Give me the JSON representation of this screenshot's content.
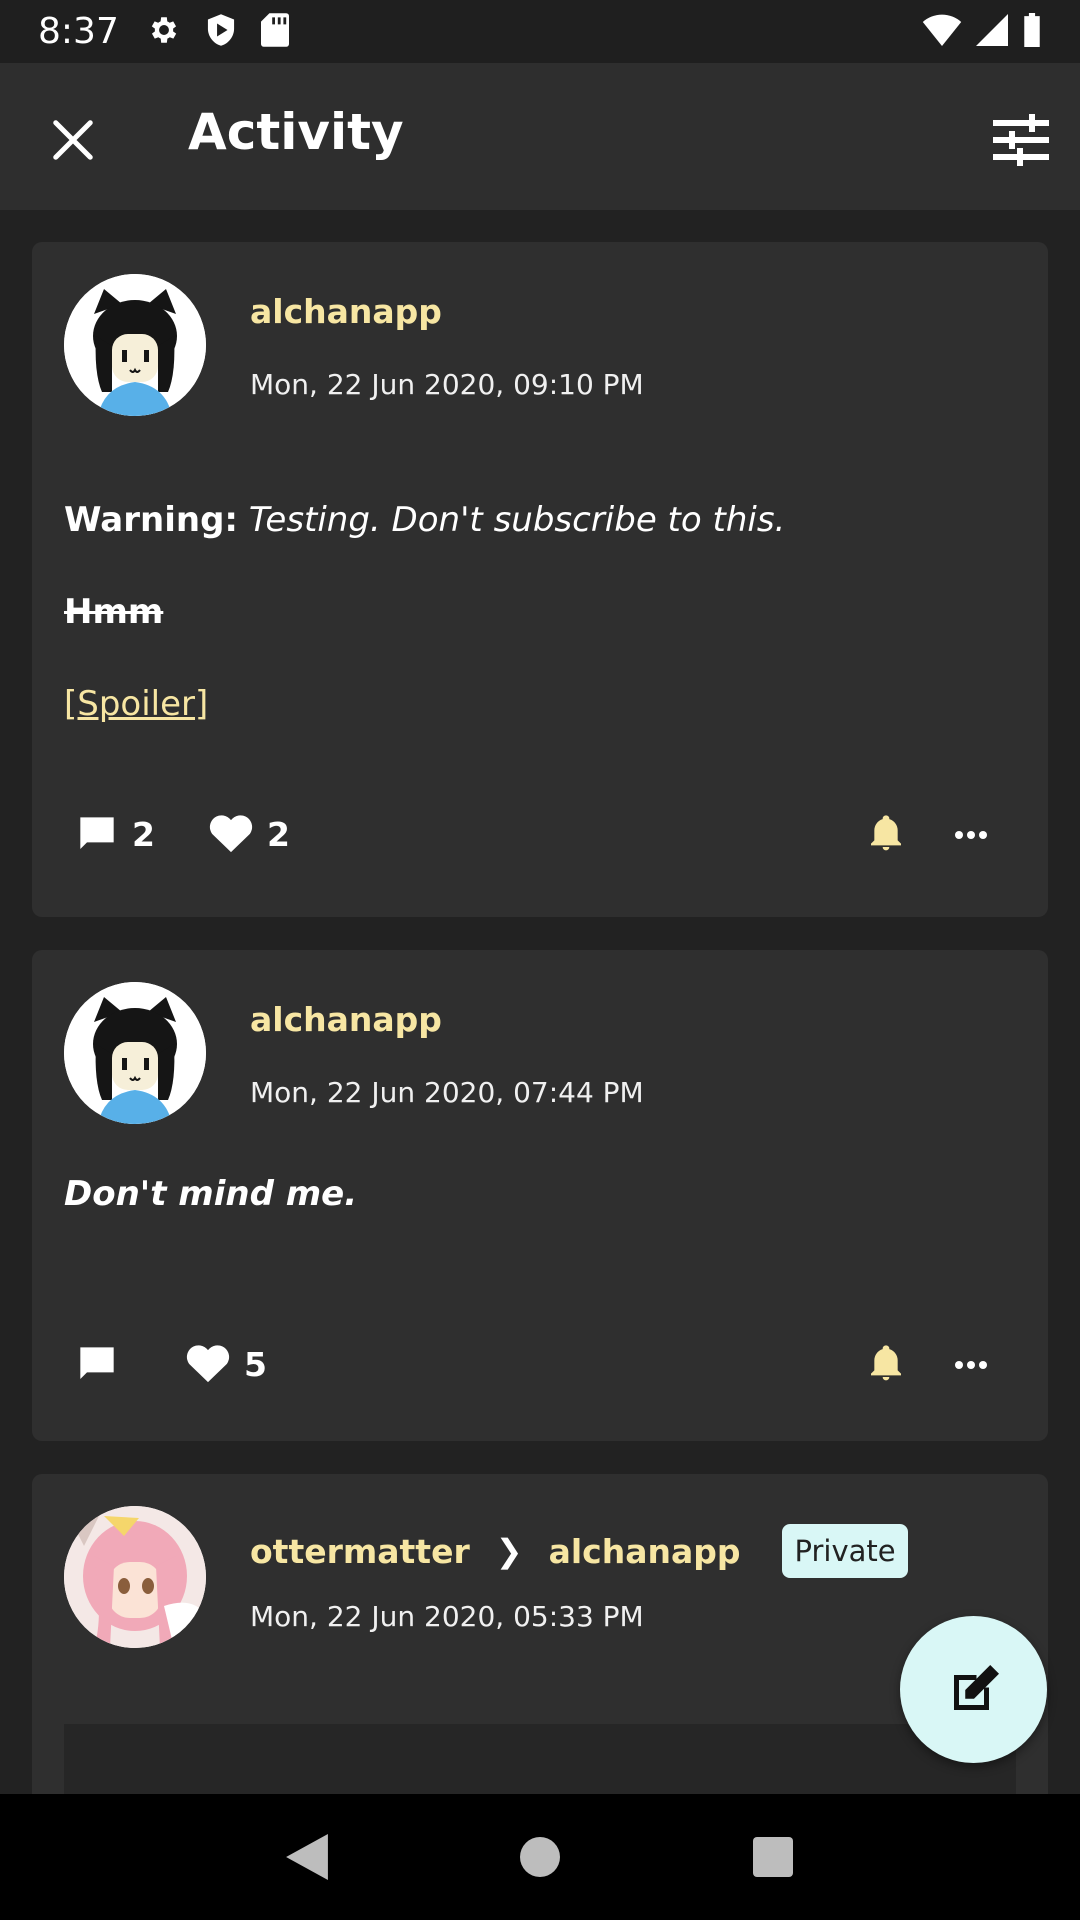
{
  "status_bar": {
    "time": "8:37",
    "icons": [
      "gear-icon",
      "shield-play-icon",
      "sd-card-icon",
      "wifi-icon",
      "signal-icon",
      "battery-icon"
    ]
  },
  "app_bar": {
    "title": "Activity",
    "close_icon": "close-icon",
    "filter_icon": "tune-icon"
  },
  "posts": [
    {
      "username": "alchanapp",
      "date": "Mon, 22 Jun 2020, 09:10 PM",
      "warning_label": "Warning:",
      "warning_text": "Testing. Don't subscribe to this.",
      "strike_text": "Hmm",
      "spoiler_text": "[Spoiler]",
      "reply_count": "2",
      "like_count": "2"
    },
    {
      "username": "alchanapp",
      "date": "Mon, 22 Jun 2020, 07:44 PM",
      "body": "Don't mind me.",
      "reply_count": "",
      "like_count": "5"
    },
    {
      "sender": "ottermatter",
      "arrow": "❯",
      "recipient": "alchanapp",
      "badge": "Private",
      "date": "Mon, 22 Jun 2020, 05:33 PM"
    }
  ],
  "colors": {
    "accent": "#f7e6a3",
    "fab": "#d9f7f6",
    "card": "#2f2f2f",
    "background": "#222222"
  }
}
